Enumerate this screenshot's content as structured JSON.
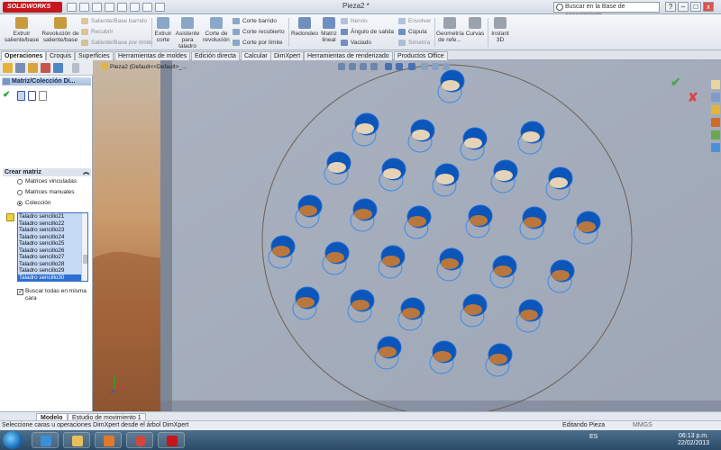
{
  "app": {
    "brand": "SOLIDWORKS",
    "title": "Pieza2 *"
  },
  "search": {
    "placeholder": "Buscar en la Base de conocimiento"
  },
  "window_buttons": [
    "–",
    "□",
    "x"
  ],
  "ribbon": {
    "large": [
      {
        "label1": "Extruir",
        "label2": "saliente/base",
        "icon_color": "#c79a3c"
      },
      {
        "label1": "Revolución de",
        "label2": "saliente/base",
        "icon_color": "#c79a3c"
      },
      {
        "label1": "Extruir",
        "label2": "corte",
        "icon_color": "#8aa6c8"
      },
      {
        "label1": "Asistente",
        "label2": "para taladro",
        "icon_color": "#8aa6c8"
      },
      {
        "label1": "Corte de",
        "label2": "revolución",
        "icon_color": "#8aa6c8"
      },
      {
        "label1": "Redondeo",
        "label2": "",
        "icon_color": "#6f8fbf"
      },
      {
        "label1": "Matriz",
        "label2": "lineal",
        "icon_color": "#6f8fbf"
      },
      {
        "label1": "Geometría",
        "label2": "de refe...",
        "icon_color": "#9aa3ad"
      },
      {
        "label1": "Curvas",
        "label2": "",
        "icon_color": "#9aa3ad"
      },
      {
        "label1": "Instant",
        "label2": "3D",
        "icon_color": "#9aa3ad"
      }
    ],
    "small": [
      {
        "label": "Saliente/Base barrido",
        "grey": true
      },
      {
        "label": "Recubrir",
        "grey": true
      },
      {
        "label": "Saliente/Base por límite",
        "grey": true
      },
      {
        "label": "Corte barrido",
        "grey": false
      },
      {
        "label": "Corte recubierto",
        "grey": false
      },
      {
        "label": "Corte por límite",
        "grey": false
      },
      {
        "label": "Nervio",
        "grey": true
      },
      {
        "label": "Ángulo de salida",
        "grey": false
      },
      {
        "label": "Vaciado",
        "grey": false
      },
      {
        "label": "Envolver",
        "grey": true
      },
      {
        "label": "Cúpula",
        "grey": false
      },
      {
        "label": "Simetría",
        "grey": true
      }
    ]
  },
  "tabs": [
    "Operaciones",
    "Croquis",
    "Superficies",
    "Herramientas de moldes",
    "Edición directa",
    "Calcular",
    "DimXpert",
    "Herramientas de renderizado",
    "Productos Office"
  ],
  "property_manager": {
    "title": "Matriz/Colección Di...",
    "group": "Crear matriz",
    "options": [
      "Matrices vinculadas",
      "Matrices manuales",
      "Colección"
    ],
    "selected_option": "Colección",
    "list": [
      "Taladro sencillo21",
      "Taladro sencillo22",
      "Taladro sencillo23",
      "Taladro sencillo24",
      "Taladro sencillo25",
      "Taladro sencillo26",
      "Taladro sencillo27",
      "Taladro sencillo28",
      "Taladro sencillo29",
      "Taladro sencillo30"
    ],
    "selected_item": "Taladro sencillo30",
    "checkbox": "Buscar todas en misma cara",
    "checked": true
  },
  "viewport": {
    "breadcrumb": "Pieza2  (Default<<Default>_...",
    "ok": "✔",
    "cancel": "✘",
    "triad_labels": [
      "Y",
      "X",
      "Z"
    ]
  },
  "bottom_tabs": [
    "Modelo",
    "Estudio de movimiento 1"
  ],
  "status": {
    "message": "Seleccione caras u operaciones DimXpert desde el árbol DimXpert",
    "mode": "Editando Pieza",
    "units": "MMGS"
  },
  "taskbar": {
    "language": "ES",
    "time": "06:13 p.m.",
    "date": "22/02/2013"
  }
}
